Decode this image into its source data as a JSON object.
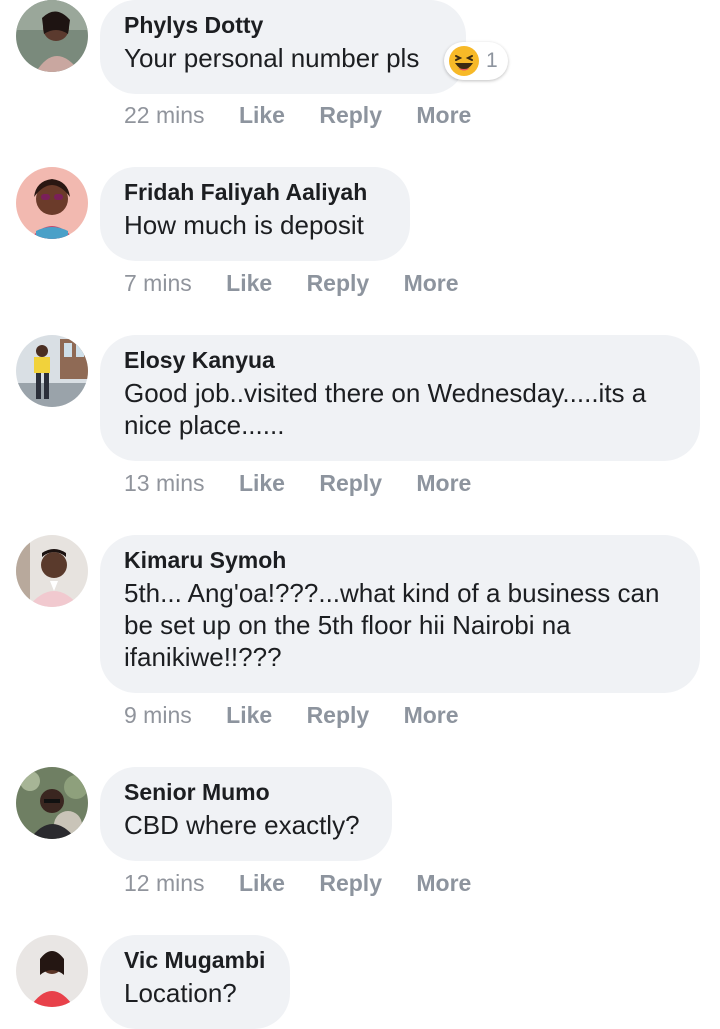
{
  "actions": {
    "like": "Like",
    "reply": "Reply",
    "more": "More"
  },
  "comments": [
    {
      "author": "Phylys Dotty",
      "text": "Your personal number pls",
      "time": "22 mins",
      "reaction": {
        "icon": "haha-emoji",
        "count": "1"
      }
    },
    {
      "author": "Fridah Faliyah Aaliyah",
      "text": "How much is deposit",
      "time": "7 mins"
    },
    {
      "author": "Elosy Kanyua",
      "text": "Good job..visited there on Wednesday.....its a nice place......",
      "time": "13 mins"
    },
    {
      "author": "Kimaru Symoh",
      "text": "5th... Ang'oa!???...what kind of a business can be set up on the 5th floor hii Nairobi na ifanikiwe!!???",
      "time": "9 mins"
    },
    {
      "author": "Senior Mumo",
      "text": "CBD where exactly?",
      "time": "12 mins"
    },
    {
      "author": "Vic Mugambi",
      "text": "Location?"
    }
  ],
  "colors": {
    "bubble": "#f0f2f5",
    "text": "#1c1e21",
    "meta": "#8d949e",
    "reaction": "#f7b928"
  }
}
